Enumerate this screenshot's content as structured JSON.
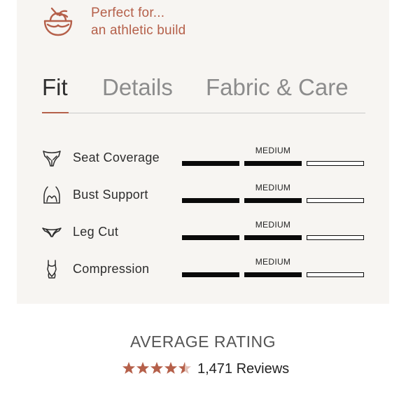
{
  "perfect": {
    "line1": "Perfect for...",
    "line2": "an athletic build",
    "icon": "coconut-drink-icon"
  },
  "tabs": [
    {
      "label": "Fit",
      "active": true
    },
    {
      "label": "Details",
      "active": false
    },
    {
      "label": "Fabric & Care",
      "active": false
    }
  ],
  "fit": {
    "rows": [
      {
        "label": "Seat Coverage",
        "value": "MEDIUM",
        "level": 2,
        "max": 3,
        "icon": "bikini-bottom-icon"
      },
      {
        "label": "Bust Support",
        "value": "MEDIUM",
        "level": 2,
        "max": 3,
        "icon": "bikini-top-icon"
      },
      {
        "label": "Leg Cut",
        "value": "MEDIUM",
        "level": 2,
        "max": 3,
        "icon": "brief-leg-cut-icon"
      },
      {
        "label": "Compression",
        "value": "MEDIUM",
        "level": 2,
        "max": 3,
        "icon": "one-piece-swimsuit-icon"
      }
    ]
  },
  "rating": {
    "title": "AVERAGE RATING",
    "stars": 4.5,
    "reviews": "1,471 Reviews"
  },
  "colors": {
    "accent": "#b5604a",
    "panel": "#f7f5f2",
    "bar": "#0a0a0a"
  }
}
